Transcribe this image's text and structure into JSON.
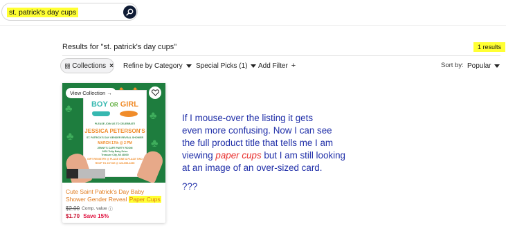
{
  "search": {
    "query": "st. patrick's day cups",
    "icon": "search-icon"
  },
  "results": {
    "title": "Results for \"st. patrick's day cups\"",
    "count": "1 results"
  },
  "filters": {
    "collections_chip": "Collections",
    "collections_icon": "grid-icon",
    "refine": "Refine by Category",
    "special": "Special Picks (1)",
    "add_filter": "Add Filter",
    "sort_label": "Sort by:",
    "sort_value": "Popular"
  },
  "card": {
    "view_collection": "View Collection →",
    "image_title_boy": "BOY",
    "image_title_or": "OR",
    "image_title_girl": "GIRL",
    "image_line1": "PLEASE JOIN US TO CELEBRATE",
    "image_name": "JESSICA PETERSON'S",
    "image_line2": "ST. PATRICK'S DAY GENDER REVEAL SHOWER",
    "image_date": "MARCH 17th @ 2 PM",
    "image_line3": "JENNY'S CAFE PARTY ROOM",
    "image_line4": "2002 Tulip Baby Drive",
    "image_line5": "Treasure City, MI 48000",
    "image_line6": "GIFT REGISTRY @ PLACE ONE & PLACE TWO",
    "image_line7": "RSVP TO JOYCE @ 123-555-2255",
    "product_title_prefix": "Cute Saint Patrick's Day Baby Shower Gender Reveal",
    "product_title_highlight": "Paper Cups",
    "price_original": "$2.00",
    "comp_value": "Comp. value",
    "price_now": "$1.70",
    "save": "Save 15%"
  },
  "annotation": {
    "line1": "If I mouse-over the listing it gets",
    "line2": "even more confusing. Now I can see",
    "line3": "the full product title that tells me I am",
    "line4_prefix": "viewing ",
    "line4_emphasis": "paper cups",
    "line4_suffix": " but I am still looking",
    "line5": "at an image of an over-sized card.",
    "questions": "???"
  },
  "colors": {
    "highlight": "#ffff33",
    "search_button": "#0f1b34",
    "title_orange": "#e07a1b",
    "sale_red": "#c8102e",
    "annotation_blue": "#1f2ea8",
    "annotation_red": "#e8312f"
  }
}
